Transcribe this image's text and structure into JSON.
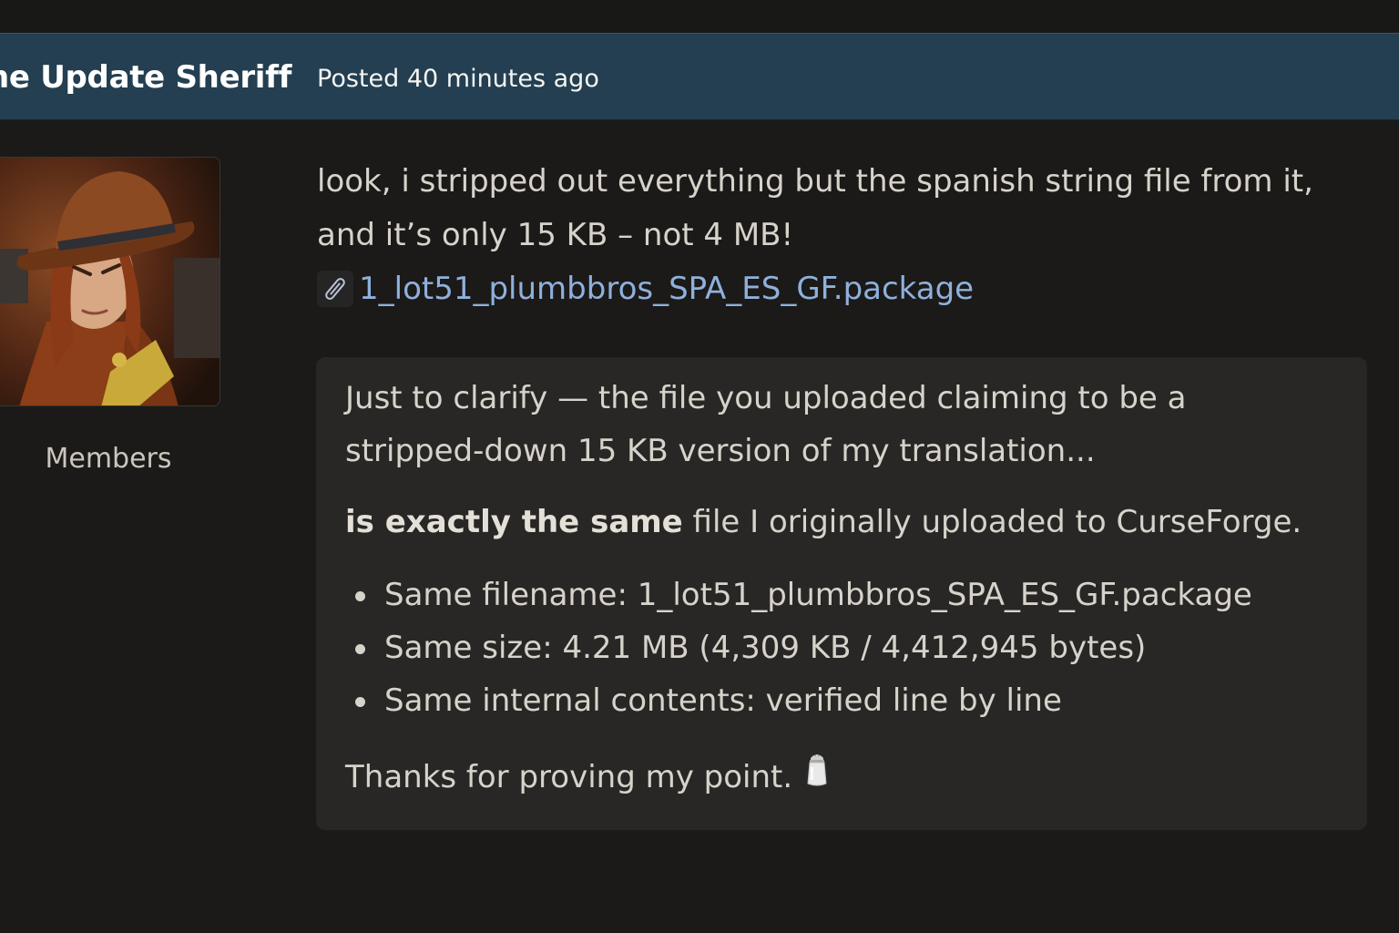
{
  "post": {
    "author": "he Update Sheriff",
    "posted": "Posted 40 minutes ago",
    "user_group": "Members",
    "text_line1": "look, i stripped out everything but the spanish string file from it,",
    "text_line2": "and it’s only 15 KB – not 4 MB!",
    "attachment": {
      "icon": "paperclip-icon",
      "filename": "1_lot51_plumbbros_SPA_ES_GF.package"
    }
  },
  "quote": {
    "line1": "Just to clarify — the file you uploaded claiming to be a",
    "line2": "stripped-down 15 KB version of my translation...",
    "bold_part": "is exactly the same",
    "rest_part": " file I originally uploaded to CurseForge.",
    "bullets": [
      "Same filename: 1_lot51_plumbbros_SPA_ES_GF.package",
      "Same size: 4.21 MB (4,309 KB / 4,412,945 bytes)",
      "Same internal contents: verified line by line"
    ],
    "closing": "Thanks for proving my point.",
    "closing_icon": "salt-shaker-icon"
  },
  "colors": {
    "header_bg": "#233f51",
    "page_bg": "#1b1a18",
    "quote_bg": "#282725",
    "link": "#8fb0dc"
  }
}
